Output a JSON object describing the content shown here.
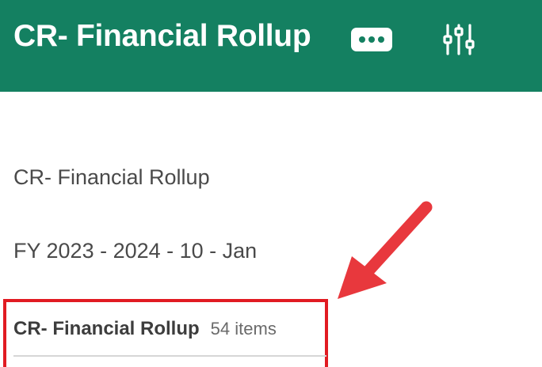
{
  "header": {
    "title": "CR- Financial Rollup",
    "more_icon": "more-horizontal-icon",
    "filter_icon": "sliders-icon",
    "background_color": "#148061"
  },
  "main": {
    "report_name": "CR- Financial Rollup",
    "period": "FY 2023 - 2024 - 10 - Jan",
    "list": {
      "title": "CR- Financial Rollup",
      "count": "54 items"
    }
  },
  "annotation": {
    "highlight_color": "#e11b22",
    "arrow_color": "#e8383d"
  }
}
